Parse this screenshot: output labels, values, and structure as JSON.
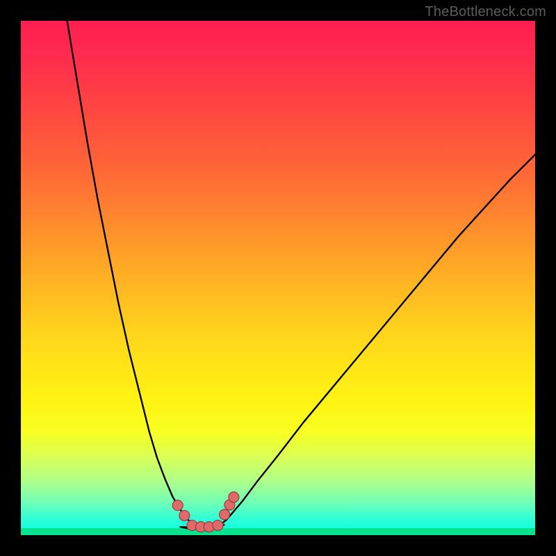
{
  "watermark": "TheBottleneck.com",
  "colors": {
    "background": "#000000",
    "gradient_top": "#ff1e50",
    "gradient_mid": "#ffe716",
    "gradient_bottom": "#04fce0",
    "curve": "#000000",
    "marker_fill": "#e06a6a",
    "marker_stroke": "#9c3a3a"
  },
  "chart_data": {
    "type": "line",
    "title": "",
    "xlabel": "",
    "ylabel": "",
    "xlim": [
      0,
      100
    ],
    "ylim": [
      0,
      100
    ],
    "grid": false,
    "legend": false,
    "series": [
      {
        "name": "left-branch",
        "x": [
          9,
          11,
          13,
          15,
          17,
          19,
          21,
          23,
          25,
          26.5,
          28,
          29.5,
          31,
          32,
          33.5,
          35
        ],
        "values": [
          100,
          88,
          76,
          65,
          55,
          45,
          36,
          28,
          20,
          15,
          11,
          7.5,
          5,
          3.5,
          2,
          1.4
        ]
      },
      {
        "name": "floor",
        "x": [
          31,
          32.5,
          34,
          35.5,
          37,
          38.5,
          39.5
        ],
        "values": [
          1.6,
          1.3,
          1.25,
          1.25,
          1.3,
          1.45,
          2.0
        ]
      },
      {
        "name": "right-branch",
        "x": [
          38,
          40,
          43,
          46,
          50,
          55,
          60,
          65,
          70,
          75,
          80,
          85,
          90,
          95,
          100
        ],
        "values": [
          1.4,
          3,
          6.5,
          10.5,
          15.5,
          22,
          28,
          34,
          40,
          46,
          52,
          58,
          63.5,
          69,
          74
        ]
      }
    ],
    "markers": [
      {
        "x": 30.5,
        "y": 5.8
      },
      {
        "x": 31.8,
        "y": 3.8
      },
      {
        "x": 33.3,
        "y": 1.9
      },
      {
        "x": 35.0,
        "y": 1.6
      },
      {
        "x": 36.6,
        "y": 1.6
      },
      {
        "x": 38.3,
        "y": 1.9
      },
      {
        "x": 39.6,
        "y": 4.0
      },
      {
        "x": 40.6,
        "y": 5.9
      },
      {
        "x": 41.4,
        "y": 7.4
      }
    ]
  }
}
